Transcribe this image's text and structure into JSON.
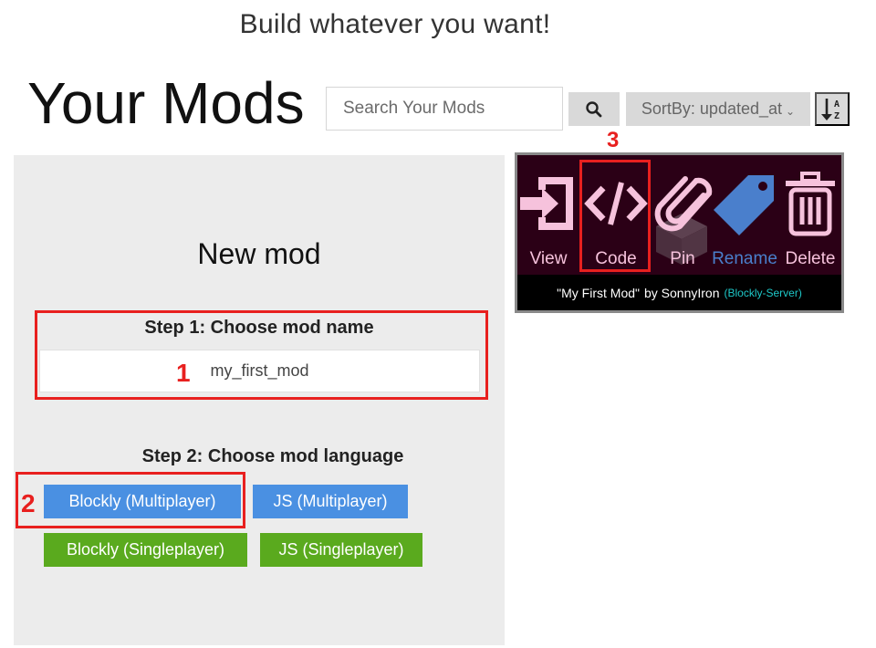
{
  "header": {
    "tagline": "Build whatever you want!",
    "title": "Your Mods",
    "search": {
      "placeholder": "Search Your Mods",
      "value": ""
    },
    "search_button_icon": "search-icon",
    "sort": {
      "label": "SortBy: updated_at",
      "icon": "chevron-down-icon"
    },
    "sort_direction_icon": "sort-alpha-down-icon"
  },
  "new_mod": {
    "title": "New mod",
    "step1_label": "Step 1: Choose mod name",
    "mod_name": {
      "value": "my_first_mod",
      "placeholder": ""
    },
    "step2_label": "Step 2: Choose mod language",
    "languages": [
      {
        "label": "Blockly (Multiplayer)",
        "color": "#4a90e2"
      },
      {
        "label": "JS (Multiplayer)",
        "color": "#4a90e2"
      },
      {
        "label": "Blockly (Singleplayer)",
        "color": "#5aaa1e"
      },
      {
        "label": "JS (Singleplayer)",
        "color": "#5aaa1e"
      }
    ]
  },
  "mod_card": {
    "actions": [
      {
        "label": "View",
        "icon": "enter-icon"
      },
      {
        "label": "Code",
        "icon": "code-icon"
      },
      {
        "label": "Pin",
        "icon": "paperclip-icon"
      },
      {
        "label": "Rename",
        "icon": "tag-icon"
      },
      {
        "label": "Delete",
        "icon": "trash-icon"
      }
    ],
    "mod_name": "\"My First Mod\"",
    "by": "by SonnyIron",
    "server_type": "(Blockly-Server)",
    "colors": {
      "background": "#2b0016",
      "icon": "#f6c2dc",
      "rename": "#4a7fcc",
      "server": "#1ec8c8"
    }
  },
  "annotations": [
    "1",
    "2",
    "3"
  ]
}
